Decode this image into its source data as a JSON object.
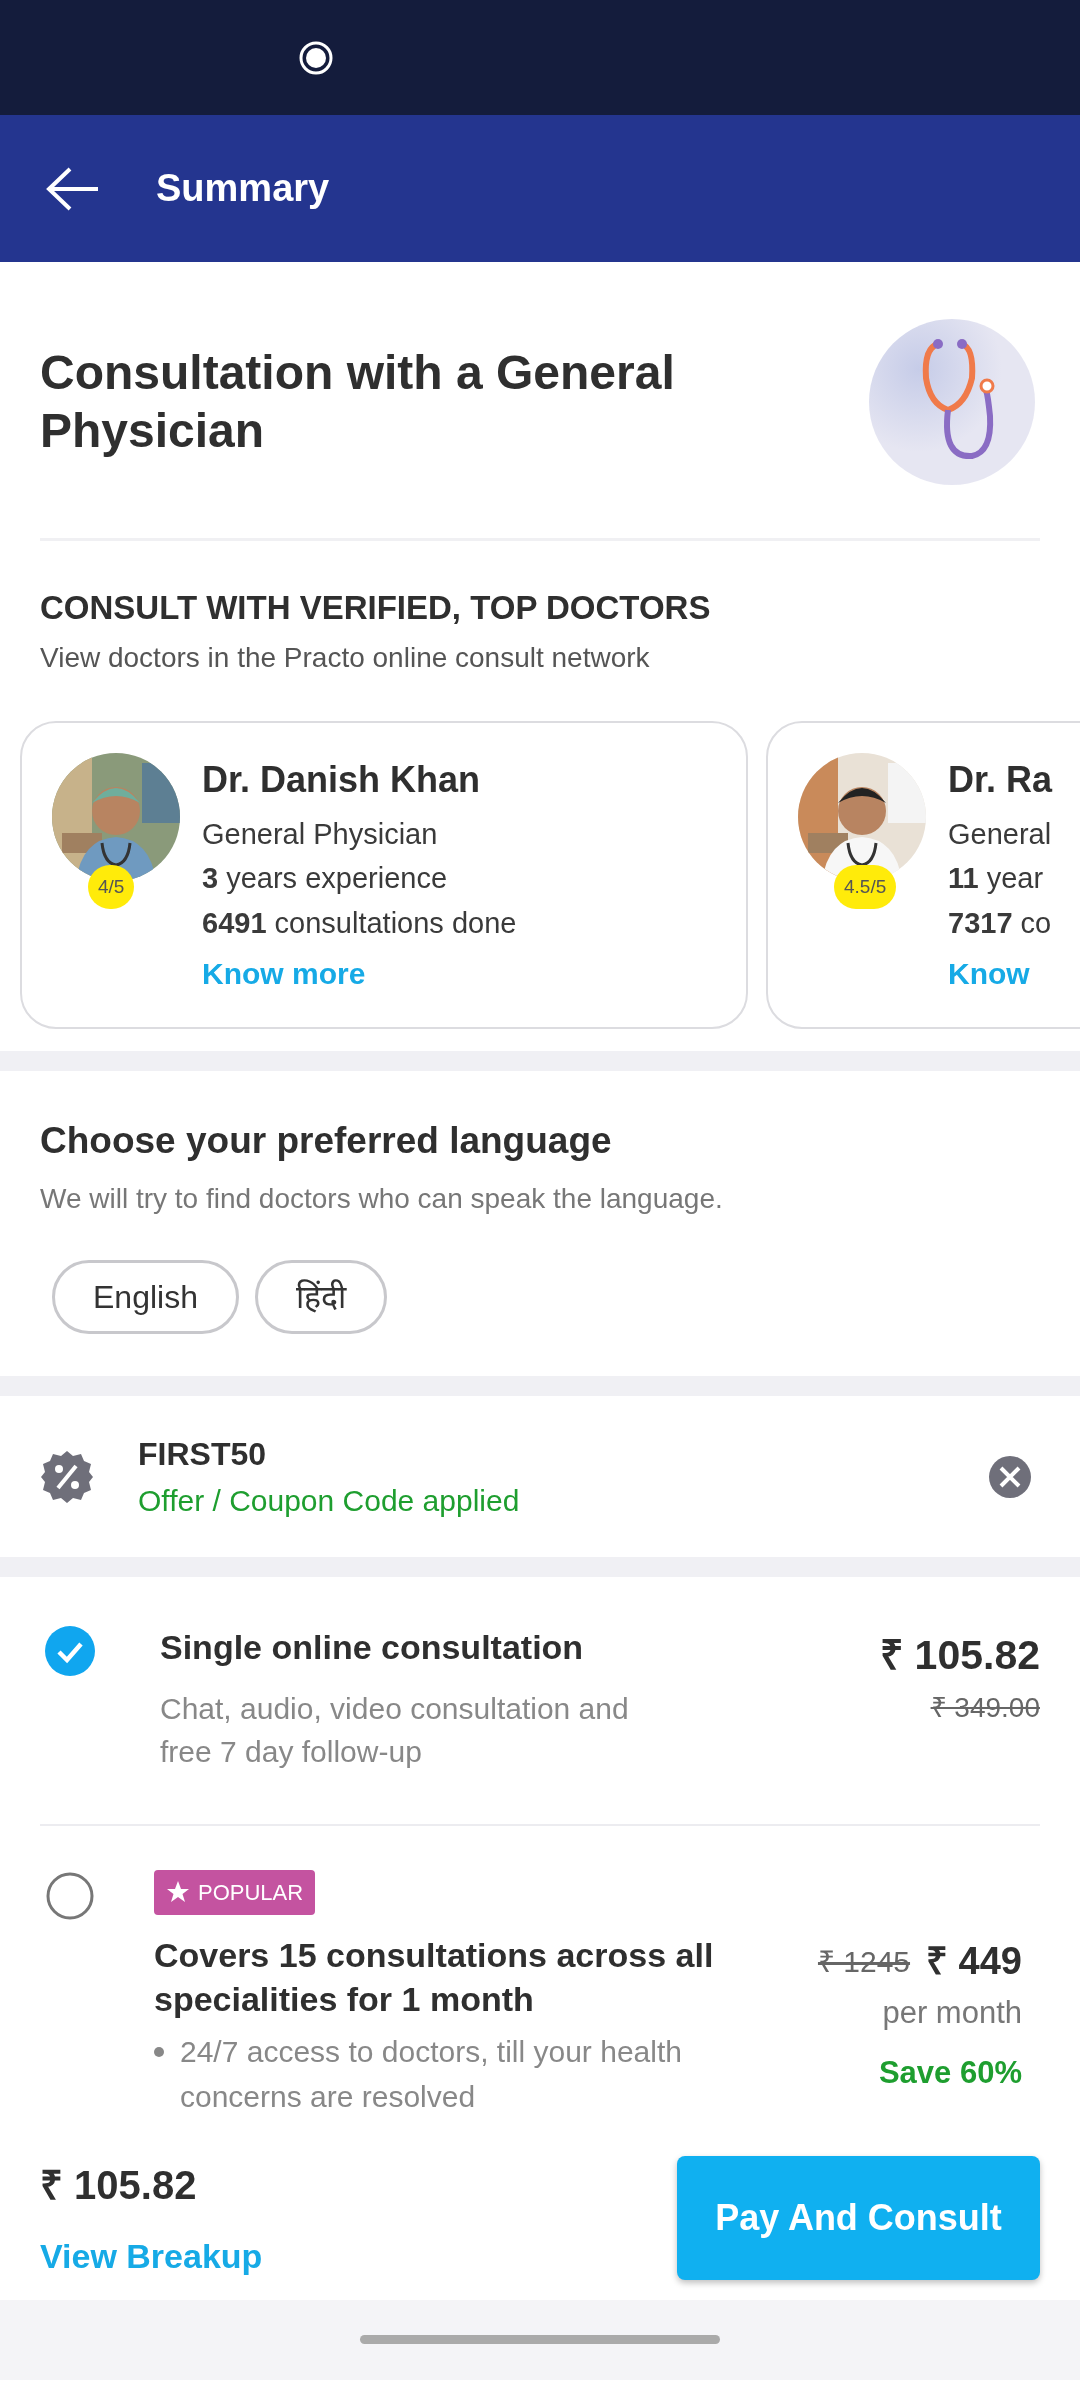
{
  "app_bar": {
    "title": "Summary"
  },
  "header": {
    "title": "Consultation with a General Physician"
  },
  "doctors_section": {
    "title": "CONSULT WITH VERIFIED, TOP DOCTORS",
    "subtitle": "View doctors in the Practo online consult network",
    "doctors": [
      {
        "name": "Dr. Danish Khan",
        "specialty": "General Physician",
        "experience": "**3** years experience",
        "consultations": "**6491** consultations done",
        "rating": "4/5",
        "link": "Know more"
      },
      {
        "name": "Dr. Ra",
        "specialty": "General",
        "experience": "**11** year",
        "consultations": "**7317** co",
        "rating": "4.5/5",
        "link": "Know"
      }
    ]
  },
  "language": {
    "title": "Choose your preferred language",
    "subtitle": "We will try to find doctors who can speak the language.",
    "options": [
      {
        "label": "English",
        "selected": false
      },
      {
        "label": "हिंदी",
        "selected": false
      }
    ]
  },
  "coupon": {
    "code": "FIRST50",
    "status": "Offer / Coupon Code applied"
  },
  "plans": [
    {
      "kind": "single",
      "selected": true,
      "title": "Single online consultation",
      "description": "Chat, audio, video consultation and free 7 day follow-up",
      "price": "₹ 105.82",
      "original_price": "₹ 349.00"
    },
    {
      "kind": "subscription",
      "selected": false,
      "badge": "POPULAR",
      "title": "Covers 15 consultations across all specialities for 1 month",
      "bullets": [
        "24/7 access to doctors, till your health concerns are resolved"
      ],
      "original_price": "₹ 1245",
      "price": "₹ 449",
      "period": "per month",
      "savings": "Save 60%"
    }
  ],
  "footer": {
    "total": "₹ 105.82",
    "breakup_link": "View Breakup",
    "button": "Pay And Consult"
  }
}
